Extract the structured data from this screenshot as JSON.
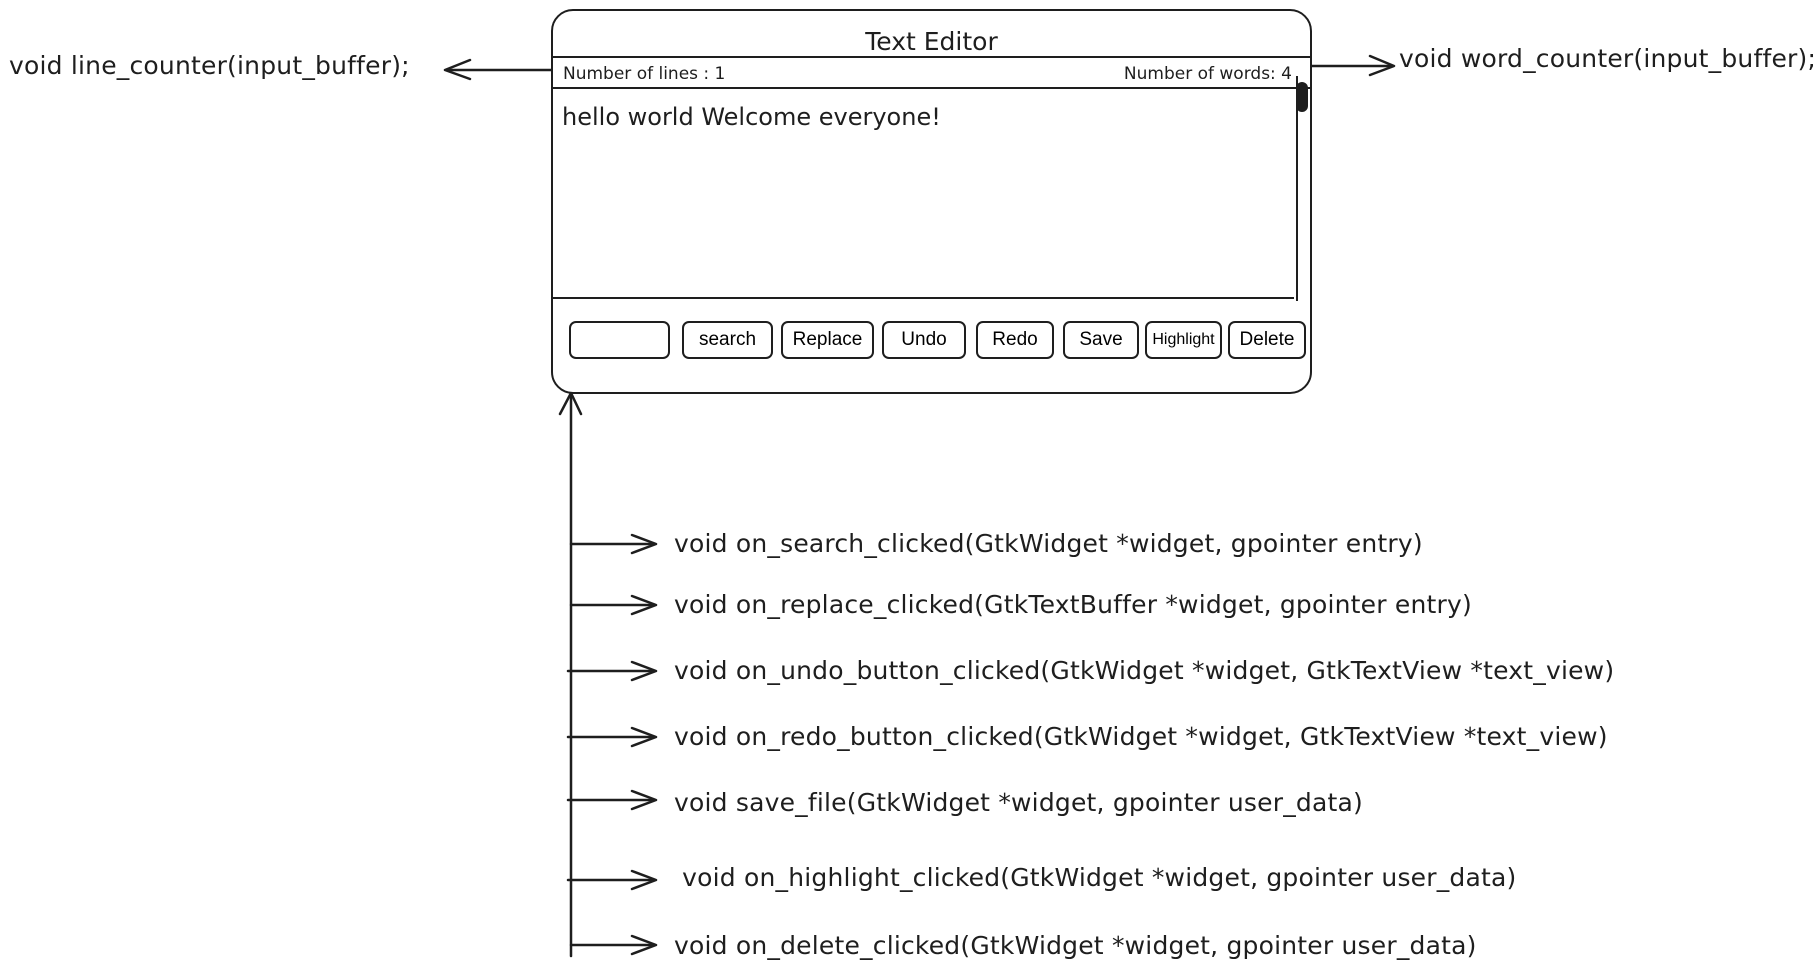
{
  "editor": {
    "title": "Text Editor",
    "status": {
      "lines": "Number of lines : 1",
      "words": "Number of words: 4"
    },
    "content": "hello world Welcome everyone!",
    "search_value": "",
    "buttons": {
      "search": "search",
      "replace": "Replace",
      "undo": "Undo",
      "redo": "Redo",
      "save": "Save",
      "highlight": "Highlight",
      "delete": "Delete"
    }
  },
  "annotations": {
    "line_counter": "void line_counter(input_buffer);",
    "word_counter": "void word_counter(input_buffer);",
    "handlers": [
      "void on_search_clicked(GtkWidget *widget, gpointer entry)",
      "void on_replace_clicked(GtkTextBuffer *widget, gpointer entry)",
      "void on_undo_button_clicked(GtkWidget *widget, GtkTextView *text_view)",
      "void on_redo_button_clicked(GtkWidget *widget, GtkTextView *text_view)",
      "void save_file(GtkWidget *widget, gpointer user_data)",
      " void on_highlight_clicked(GtkWidget *widget, gpointer user_data)",
      "void on_delete_clicked(GtkWidget *widget, gpointer user_data)"
    ]
  }
}
